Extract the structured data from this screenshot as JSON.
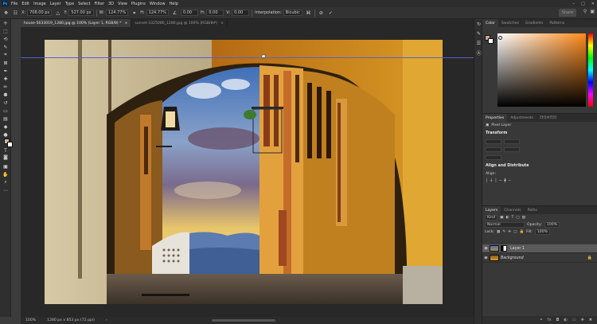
{
  "app": {
    "logo": "Ps"
  },
  "menu": [
    "File",
    "Edit",
    "Image",
    "Layer",
    "Type",
    "Select",
    "Filter",
    "3D",
    "View",
    "Plugins",
    "Window",
    "Help"
  ],
  "window_controls": [
    "–",
    "□",
    "✕"
  ],
  "options": {
    "x_label": "X:",
    "x_value": "708.00 px",
    "y_label": "Y:",
    "y_value": "527.00 px",
    "w_label": "W:",
    "w_value": "124.77%",
    "h_label": "H:",
    "h_value": "124.77%",
    "angle_value": "0.00",
    "hskew_label": "H:",
    "hskew_value": "0.00",
    "vskew_label": "V:",
    "vskew_value": "0.00",
    "interp_label": "Interpolation:",
    "interp_value": "Bicubic",
    "share_label": "Share"
  },
  "tabs": [
    {
      "label": "house-5633019_1280.jpg @ 100% (Layer 1, RGB/8) *",
      "close": "×"
    },
    {
      "label": "sunset-3325080_1280.jpg @ 100% (RGB/8#)",
      "close": "×"
    }
  ],
  "status": {
    "zoom": "100%",
    "doc_info": "1280 px x 853 px (72 ppi)",
    "arrow": "›"
  },
  "color_panel": {
    "tabs": [
      "Color",
      "Swatches",
      "Gradients",
      "Patterns"
    ]
  },
  "properties": {
    "tabs": [
      "Properties",
      "Adjustments",
      "라이브러리"
    ],
    "kind": "Pixel Layer",
    "transform_label": "Transform",
    "align_label": "Align and Distribute",
    "align_sub": "Align:"
  },
  "layers": {
    "tabs": [
      "Layers",
      "Channels",
      "Paths"
    ],
    "kind_label": "Kind",
    "blend_mode": "Normal",
    "opacity_label": "Opacity:",
    "opacity_value": "100%",
    "lock_label": "Lock:",
    "fill_label": "Fill:",
    "fill_value": "100%",
    "items": [
      {
        "name": "Layer 1",
        "selected": true
      },
      {
        "name": "Background",
        "selected": false,
        "italic": true
      }
    ]
  }
}
